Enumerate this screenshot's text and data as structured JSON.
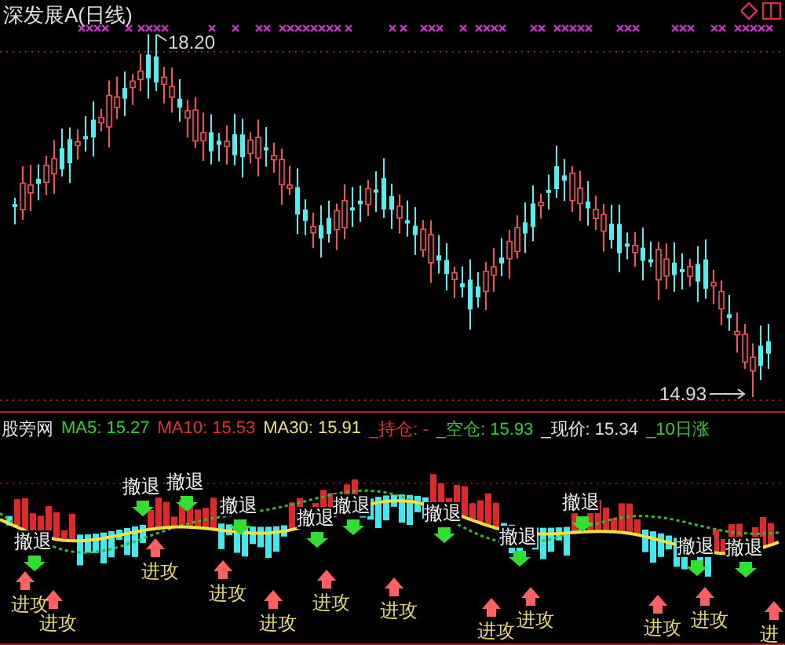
{
  "title": "深发展A(日线)",
  "price_chart": {
    "high_label": "18.20",
    "low_label": "14.93"
  },
  "indicator": {
    "name": "股旁网",
    "readouts": [
      {
        "text": "MA5: 15.27",
        "color": "#33cc33"
      },
      {
        "text": "MA10: 15.53",
        "color": "#e03030"
      },
      {
        "text": "MA30: 15.91",
        "color": "#e8e070"
      },
      {
        "text": "_持仓: -",
        "color": "#e03030"
      },
      {
        "text": "_空仓: 15.93",
        "color": "#33cc33"
      },
      {
        "text": "_现价: 15.34",
        "color": "#e0e0e0"
      },
      {
        "text": "_10日涨",
        "color": "#33cc33"
      }
    ],
    "retreat_labels": [
      "撤退",
      "撤退",
      "撤退",
      "撤退",
      "撤退",
      "撤退",
      "撤退",
      "撤退",
      "撤退",
      "撤退",
      "撤退"
    ],
    "attack_labels": [
      "进攻",
      "进攻",
      "进攻",
      "进攻",
      "进攻",
      "进攻",
      "进攻",
      "进攻",
      "进攻",
      "进攻",
      "进攻",
      "进"
    ]
  }
}
